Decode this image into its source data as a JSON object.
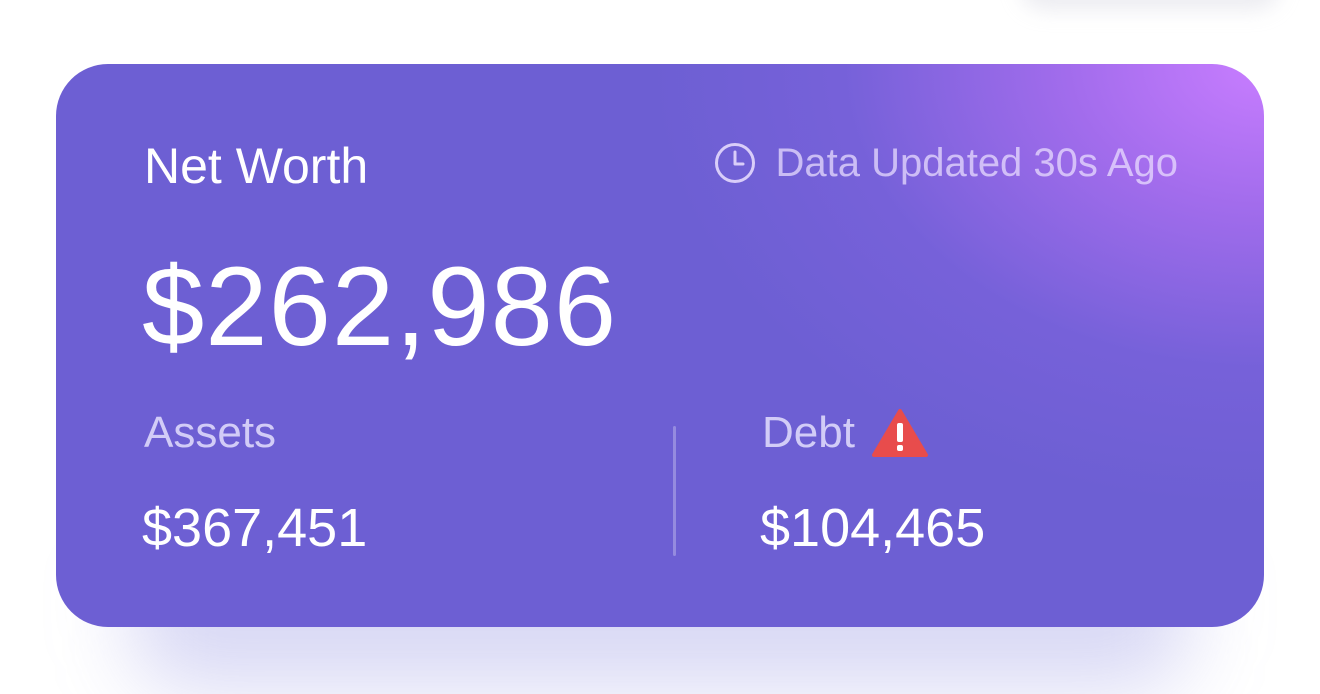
{
  "card": {
    "title": "Net Worth",
    "updated_text": "Data Updated 30s Ago",
    "net_worth": "$262,986",
    "assets": {
      "label": "Assets",
      "value": "$367,451"
    },
    "debt": {
      "label": "Debt",
      "value": "$104,465"
    }
  },
  "icons": {
    "updated": "clock-icon",
    "debt_alert": "warning-triangle-icon"
  },
  "colors": {
    "card_base": "#6d5fd3",
    "card_highlight": "#c87dff",
    "warning": "#e84c4c"
  }
}
